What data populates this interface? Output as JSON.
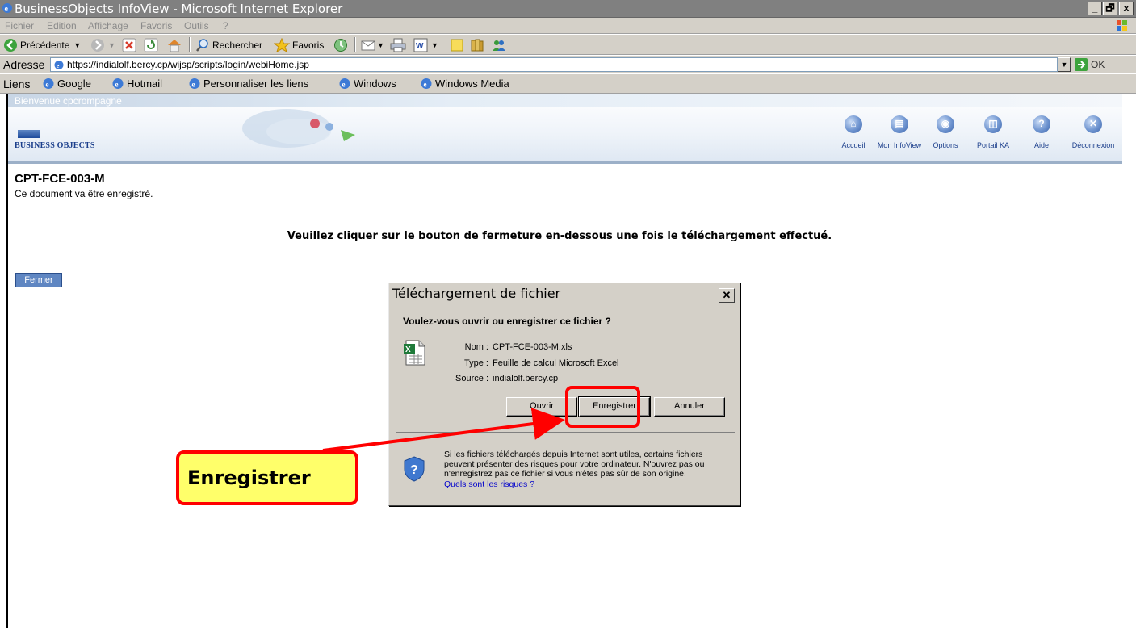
{
  "window": {
    "title": "BusinessObjects InfoView - Microsoft Internet Explorer",
    "controls": [
      "_",
      "🗗",
      "x"
    ]
  },
  "menu": [
    "Fichier",
    "Edition",
    "Affichage",
    "Favoris",
    "Outils",
    "?"
  ],
  "toolbar": {
    "back_label": "Précédente",
    "search_label": "Rechercher",
    "favorites_label": "Favoris"
  },
  "address": {
    "label": "Adresse",
    "url": "https://indialolf.bercy.cp/wijsp/scripts/login/webiHome.jsp",
    "go_label": "OK"
  },
  "links": {
    "label": "Liens",
    "items": [
      "Google",
      "Hotmail",
      "Personnaliser les liens",
      "Windows",
      "Windows Media"
    ]
  },
  "bo": {
    "welcome": "Bienvenue cpcrompagne",
    "logo_text": "BUSINESS OBJECTS",
    "nav": [
      "Accueil",
      "Mon InfoView",
      "Options",
      "Portail KA",
      "Aide",
      "Déconnexion"
    ]
  },
  "page": {
    "title": "CPT-FCE-003-M",
    "subtitle": "Ce document va être enregistré.",
    "instruction": "Veuillez cliquer sur le bouton de fermeture en-dessous une fois le téléchargement effectué.",
    "close_button": "Fermer"
  },
  "dialog": {
    "title": "Téléchargement de fichier",
    "question": "Voulez-vous ouvrir ou enregistrer ce fichier ?",
    "name_key": "Nom :",
    "name_value": "CPT-FCE-003-M.xls",
    "type_key": "Type :",
    "type_value": "Feuille de calcul Microsoft Excel",
    "source_key": "Source :",
    "source_value": "indialolf.bercy.cp",
    "open_button": "Ouvrir",
    "save_button": "Enregistrer",
    "cancel_button": "Annuler",
    "warning": "Si les fichiers téléchargés depuis Internet sont utiles, certains fichiers peuvent présenter des risques pour votre ordinateur. N'ouvrez pas ou n'enregistrez pas ce fichier si vous n'êtes pas sûr de son origine.",
    "risk_link": "Quels sont les risques ?"
  },
  "annotation": {
    "callout_text": "Enregistrer",
    "color": "#ff0000",
    "callout_bg": "#ffff6a"
  }
}
